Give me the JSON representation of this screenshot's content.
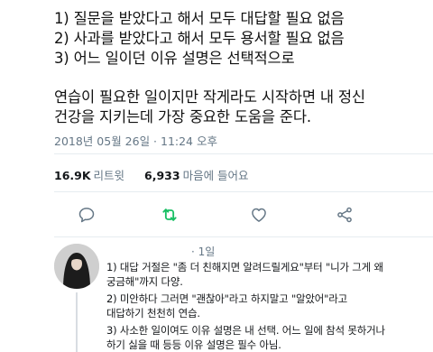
{
  "tweet": {
    "lines": [
      "1) 질문을 받았다고 해서 모두 대답할 필요 없음",
      "2) 사과를 받았다고 해서 모두 용서할 필요 없음",
      "3) 어느 일이던 이유 설명은 선택적으로",
      "연습이 필요한 일이지만 작게라도 시작하면 내 정신",
      "건강을 지키는데 가장 중요한 도움을 준다."
    ],
    "timestamp": "2018년 05월 26일 · 11:24 오후"
  },
  "stats": {
    "retweets_count": "16.9K",
    "retweets_label": "리트윗",
    "likes_count": "6,933",
    "likes_label": "마음에 들어요"
  },
  "actions": {
    "reply_icon": "reply-icon",
    "retweet_icon": "retweet-icon",
    "like_icon": "heart-icon",
    "share_icon": "share-icon",
    "retweet_color": "#17bf63"
  },
  "reply": {
    "time": "· 1일",
    "lines": [
      "1) 대답 거절은 \"좀 더 친해지면 알려드릴게요\"부터 \"니가 그게 왜",
      "궁금해\"까지 다양.",
      "2) 미안하다 그러면 \"괜찮아\"라고 하지말고 \"알았어\"라고",
      "대답하기 천천히 연습.",
      "3) 사소한 일이여도 이유 설명은 내 선택. 어느 일에 참석 못하거나",
      "하기 싫을 때 등등 이유 설명은 필수 아님."
    ]
  }
}
